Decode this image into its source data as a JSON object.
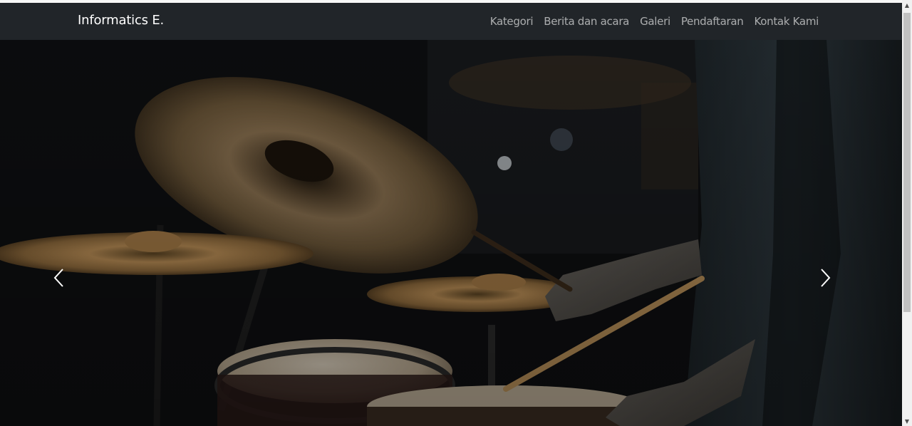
{
  "navbar": {
    "brand": "Informatics E.",
    "links": [
      "Kategori",
      "Berita dan acara",
      "Galeri",
      "Pendaftaran",
      "Kontak Kami"
    ]
  },
  "hero": {
    "image": "drummer-playing-cymbals-photo",
    "controls": {
      "prev_icon": "chevron-left-icon",
      "next_icon": "chevron-right-icon"
    }
  },
  "colors": {
    "navbar_bg": "#212529",
    "brand_text": "#ffffff",
    "nav_link": "rgba(255,255,255,0.62)"
  }
}
